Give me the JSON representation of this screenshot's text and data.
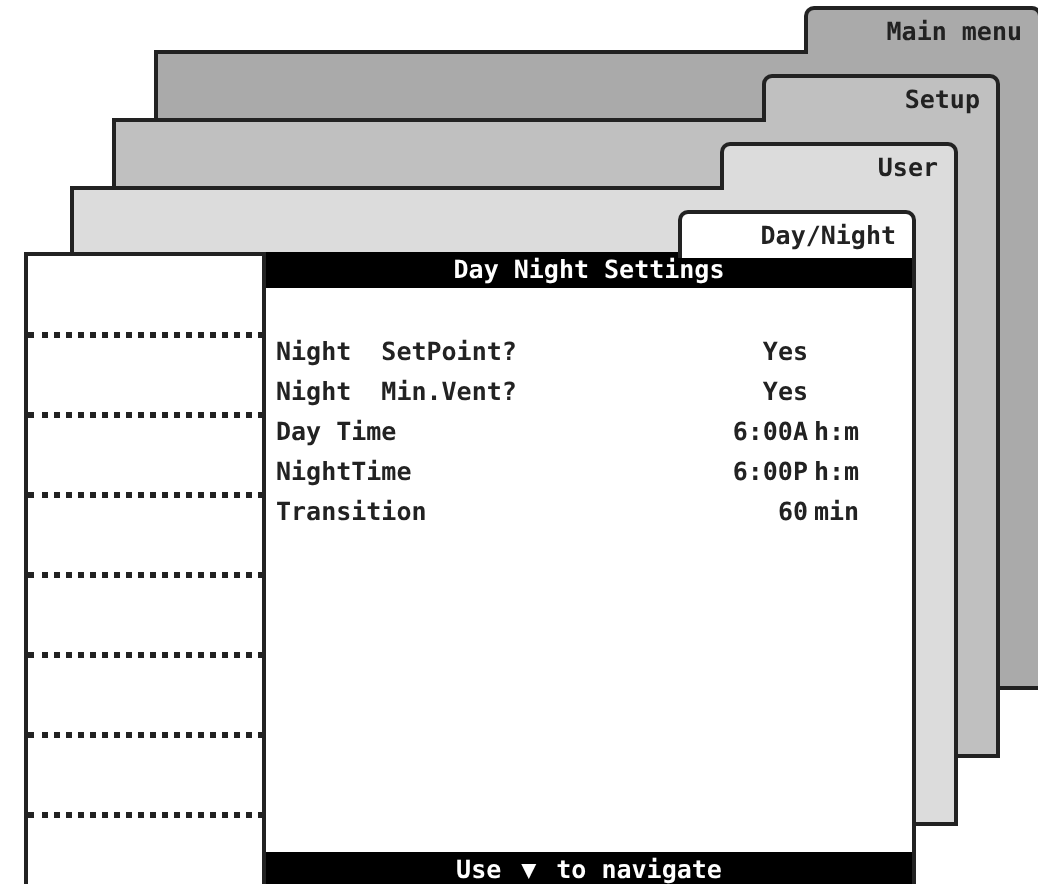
{
  "tabs": [
    {
      "label": "Main menu",
      "selected": false
    },
    {
      "label": "Setup",
      "selected": false
    },
    {
      "label": "User",
      "selected": false
    },
    {
      "label": "Day/Night",
      "selected": true
    }
  ],
  "screen": {
    "title": "Day Night Settings",
    "settings": [
      {
        "label": "Night  SetPoint?",
        "value": "Yes"
      },
      {
        "label": "Night  Min.Vent?",
        "value": "Yes"
      },
      {
        "label": "Day Time",
        "value": "6:00A",
        "unit": "h:m"
      },
      {
        "label": "NightTime",
        "value": "6:00P",
        "unit": "h:m"
      },
      {
        "label": "Transition",
        "value": "60",
        "unit": "min"
      }
    ],
    "footer": {
      "before": "Use",
      "arrow": "▼",
      "after": "to navigate"
    }
  }
}
